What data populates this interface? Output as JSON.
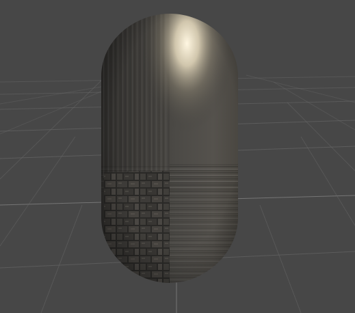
{
  "scene": {
    "background_color": "#474747",
    "grid_color": "#6a6a6a",
    "grid_axis_color": "#8a8a8a",
    "object": {
      "shape": "capsule",
      "materials": [
        "brushed-metal",
        "stone-brick"
      ],
      "highlight_color": "#fff5de",
      "base_color": "#3a3835"
    }
  }
}
